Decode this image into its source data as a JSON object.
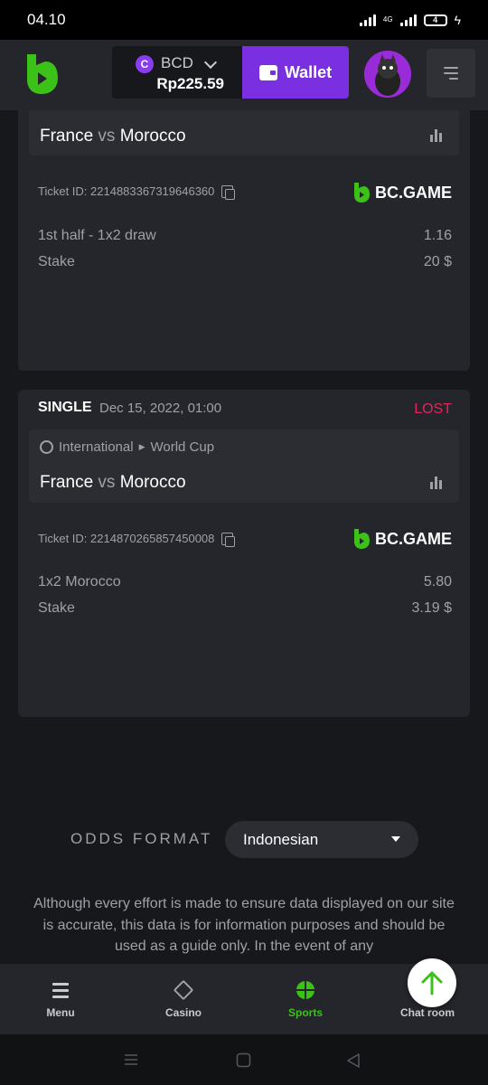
{
  "status_bar": {
    "time": "04.10",
    "network": "4G",
    "battery": "4"
  },
  "header": {
    "currency": "BCD",
    "currency_symbol": "C",
    "balance": "Rp225.59",
    "wallet_label": "Wallet"
  },
  "bets": [
    {
      "league": "",
      "home_team": "France",
      "vs": "vs",
      "away_team": "Morocco",
      "ticket_id": "Ticket ID: 2214883367319646360",
      "brand": "BC.GAME",
      "selection": "1st half - 1x2 draw",
      "odds": "1.16",
      "stake_label": "Stake",
      "stake_value": "20 $"
    },
    {
      "type": "SINGLE",
      "date": "Dec 15, 2022, 01:00",
      "result": "LOST",
      "league_country": "International",
      "league_name": "World Cup",
      "home_team": "France",
      "vs": "vs",
      "away_team": "Morocco",
      "ticket_id": "Ticket ID: 2214870265857450008",
      "brand": "BC.GAME",
      "selection": "1x2 Morocco",
      "odds": "5.80",
      "stake_label": "Stake",
      "stake_value": "3.19 $"
    }
  ],
  "odds_format": {
    "label": "ODDS FORMAT",
    "value": "Indonesian"
  },
  "disclaimer": "Although every effort is made to ensure data displayed on our site is accurate, this data is for information purposes and should be used as a guide only. In the event of any",
  "bottom_nav": [
    {
      "label": "Menu"
    },
    {
      "label": "Casino"
    },
    {
      "label": "Sports"
    },
    {
      "label": "Chat room"
    }
  ],
  "colors": {
    "accent_green": "#3bc117",
    "accent_purple": "#7a2fe0",
    "lost_red": "#e8245a"
  }
}
